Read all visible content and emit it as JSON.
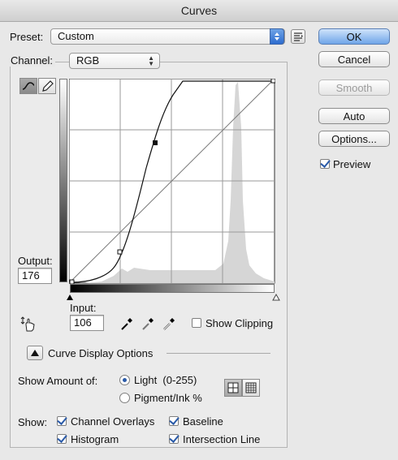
{
  "window": {
    "title": "Curves"
  },
  "preset": {
    "label": "Preset:",
    "value": "Custom"
  },
  "buttons": {
    "ok": "OK",
    "cancel": "Cancel",
    "smooth": "Smooth",
    "auto": "Auto",
    "options": "Options..."
  },
  "preview": {
    "label": "Preview",
    "checked": true
  },
  "channel": {
    "label": "Channel:",
    "value": "RGB"
  },
  "output": {
    "label": "Output:",
    "value": "176"
  },
  "input": {
    "label": "Input:",
    "value": "106"
  },
  "show_clipping": {
    "label": "Show Clipping",
    "checked": false
  },
  "display_options": {
    "label": "Curve Display Options"
  },
  "show_amount": {
    "label": "Show Amount of:",
    "light": "Light  (0-255)",
    "pigment": "Pigment/Ink %",
    "selected": "light"
  },
  "show": {
    "label": "Show:",
    "channel_overlays": "Channel Overlays",
    "baseline": "Baseline",
    "histogram": "Histogram",
    "intersection_line": "Intersection Line"
  },
  "icons": {
    "preset_menu": "list-menu-icon",
    "curve_tool": "curve-point-icon",
    "pencil_tool": "pencil-icon",
    "target_adjust": "hand-adjust-icon",
    "eyedroppers": [
      "black-eyedropper-icon",
      "gray-eyedropper-icon",
      "white-eyedropper-icon"
    ],
    "grid_simple": "grid-4-icon",
    "grid_detailed": "grid-10-icon"
  },
  "colors": {
    "accent": "#2a5aa8",
    "default_button": "#6fa5e8",
    "histogram": "#d6d6d6"
  }
}
